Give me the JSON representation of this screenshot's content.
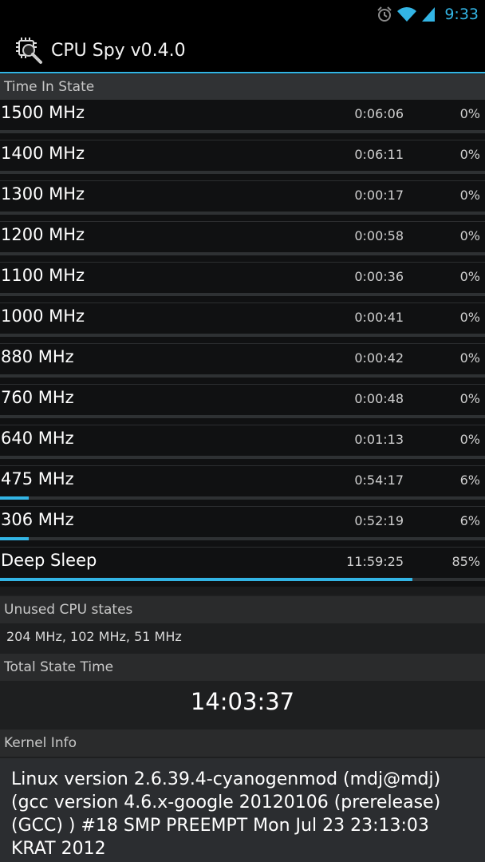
{
  "status_bar": {
    "time": "9:33",
    "icons": [
      "alarm-icon",
      "wifi-icon",
      "signal-icon"
    ],
    "accent": "#33b5e5"
  },
  "action_bar": {
    "title": "CPU Spy v0.4.0",
    "icon": "cpu-magnifier-icon"
  },
  "time_in_state": {
    "header": "Time In State",
    "rows": [
      {
        "freq": "1500 MHz",
        "duration": "0:06:06",
        "percent": "0%",
        "fraction": 0.0
      },
      {
        "freq": "1400 MHz",
        "duration": "0:06:11",
        "percent": "0%",
        "fraction": 0.0
      },
      {
        "freq": "1300 MHz",
        "duration": "0:00:17",
        "percent": "0%",
        "fraction": 0.0
      },
      {
        "freq": "1200 MHz",
        "duration": "0:00:58",
        "percent": "0%",
        "fraction": 0.0
      },
      {
        "freq": "1100 MHz",
        "duration": "0:00:36",
        "percent": "0%",
        "fraction": 0.0
      },
      {
        "freq": "1000 MHz",
        "duration": "0:00:41",
        "percent": "0%",
        "fraction": 0.0
      },
      {
        "freq": "880 MHz",
        "duration": "0:00:42",
        "percent": "0%",
        "fraction": 0.0
      },
      {
        "freq": "760 MHz",
        "duration": "0:00:48",
        "percent": "0%",
        "fraction": 0.0
      },
      {
        "freq": "640 MHz",
        "duration": "0:01:13",
        "percent": "0%",
        "fraction": 0.0
      },
      {
        "freq": "475 MHz",
        "duration": "0:54:17",
        "percent": "6%",
        "fraction": 0.06
      },
      {
        "freq": "306 MHz",
        "duration": "0:52:19",
        "percent": "6%",
        "fraction": 0.06
      },
      {
        "freq": "Deep Sleep",
        "duration": "11:59:25",
        "percent": "85%",
        "fraction": 0.85
      }
    ]
  },
  "unused": {
    "header": "Unused CPU states",
    "value": "204 MHz, 102 MHz, 51 MHz"
  },
  "total": {
    "header": "Total State Time",
    "value": "14:03:37"
  },
  "kernel": {
    "header": "Kernel Info",
    "text": "Linux version 2.6.39.4-cyanogenmod (mdj@mdj) (gcc version 4.6.x-google 20120106 (prerelease) (GCC) ) #18 SMP PREEMPT Mon Jul 23 23:13:03 KRAT 2012"
  }
}
